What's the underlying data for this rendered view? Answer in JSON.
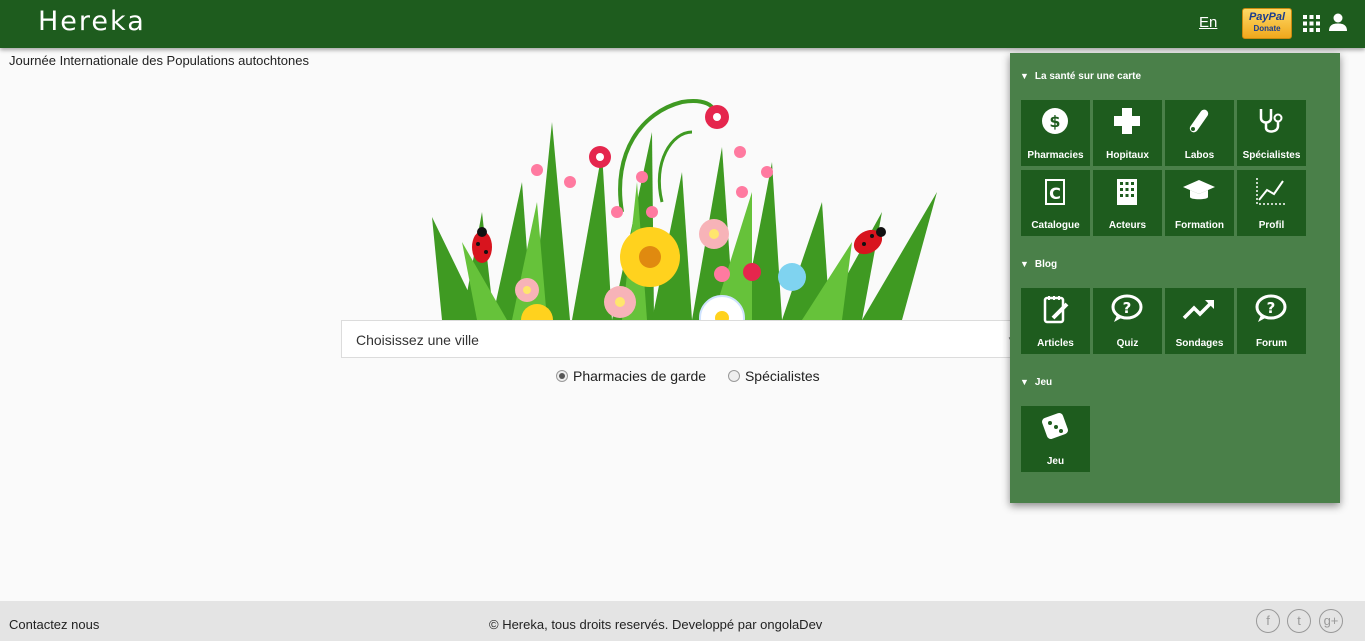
{
  "header": {
    "logo": "Hereka",
    "lang_link": "En",
    "donate": {
      "brand": "PayPal",
      "label": "Donate"
    },
    "apps_icon": "grid-icon",
    "user_icon": "user-icon"
  },
  "headline": "Journée Internationale des Populations autochtones",
  "search": {
    "city_placeholder": "Choisissez une ville"
  },
  "options": {
    "pharmacies": "Pharmacies de garde",
    "specialistes": "Spécialistes",
    "selected": "pharmacies"
  },
  "menu": {
    "sections": [
      {
        "title": "La santé sur une carte",
        "items": [
          {
            "label": "Pharmacies",
            "icon": "pharmacy-icon"
          },
          {
            "label": "Hopitaux",
            "icon": "hospital-cross-icon"
          },
          {
            "label": "Labos",
            "icon": "test-tube-icon"
          },
          {
            "label": "Spécialistes",
            "icon": "stethoscope-icon"
          },
          {
            "label": "Catalogue",
            "icon": "catalogue-icon"
          },
          {
            "label": "Acteurs",
            "icon": "building-icon"
          },
          {
            "label": "Formation",
            "icon": "graduation-cap-icon"
          },
          {
            "label": "Profil",
            "icon": "chart-icon"
          }
        ]
      },
      {
        "title": "Blog",
        "items": [
          {
            "label": "Articles",
            "icon": "notepad-pen-icon"
          },
          {
            "label": "Quiz",
            "icon": "question-bubble-icon"
          },
          {
            "label": "Sondages",
            "icon": "trending-up-icon"
          },
          {
            "label": "Forum",
            "icon": "question-bubble-icon"
          }
        ]
      },
      {
        "title": "Jeu",
        "items": [
          {
            "label": "Jeu",
            "icon": "dice-icon"
          }
        ]
      }
    ]
  },
  "footer": {
    "contact": "Contactez nous",
    "copyright": "© Hereka, tous droits reservés. Developpé par ongolaDev",
    "social": [
      {
        "icon": "facebook-icon",
        "glyph": "f"
      },
      {
        "icon": "twitter-icon",
        "glyph": "t"
      },
      {
        "icon": "google-plus-icon",
        "glyph": "g+"
      }
    ]
  },
  "colors": {
    "brand_green": "#1e5c1e",
    "panel_green": "#4a8049",
    "footer_gray": "#e4e4e4"
  }
}
